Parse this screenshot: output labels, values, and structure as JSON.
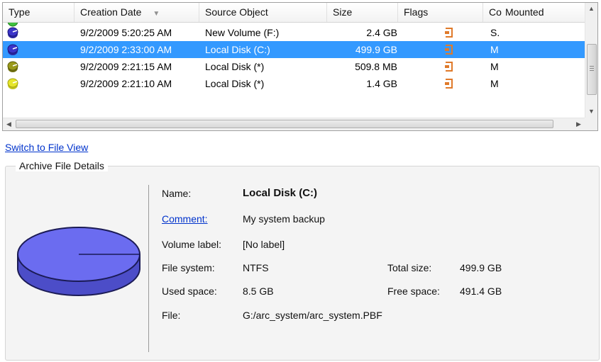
{
  "columns": {
    "type": "Type",
    "creation_date": "Creation Date",
    "source_object": "Source Object",
    "size": "Size",
    "flags": "Flags",
    "co": "Co",
    "mounted": "Mounted"
  },
  "rows": [
    {
      "date": "9/2/2009 5:20:25 AM",
      "source": "New Volume (F:)",
      "size": "2.4 GB",
      "co": "S.",
      "icon_color": "#3b34c9"
    },
    {
      "date": "9/2/2009 2:33:00 AM",
      "source": "Local Disk (C:)",
      "size": "499.9 GB",
      "co": "M",
      "icon_color": "#3b34c9"
    },
    {
      "date": "9/2/2009 2:21:15 AM",
      "source": "Local Disk (*)",
      "size": "509.8 MB",
      "co": "M",
      "icon_color": "#9a9a1a"
    },
    {
      "date": "9/2/2009 2:21:10 AM",
      "source": "Local Disk (*)",
      "size": "1.4 GB",
      "co": "M",
      "icon_color": "#e6e62a"
    }
  ],
  "selected_row": 1,
  "links": {
    "switch_view": "Switch to File View"
  },
  "details": {
    "group_title": "Archive File Details",
    "name_label": "Name:",
    "name_value": "Local Disk (C:)",
    "comment_label": "Comment:",
    "comment_value": "My system backup",
    "volume_label_label": "Volume label:",
    "volume_label_value": "[No label]",
    "file_system_label": "File system:",
    "file_system_value": "NTFS",
    "total_size_label": "Total size:",
    "total_size_value": "499.9 GB",
    "used_space_label": "Used space:",
    "used_space_value": "8.5 GB",
    "free_space_label": "Free space:",
    "free_space_value": "491.4 GB",
    "file_label": "File:",
    "file_value": "G:/arc_system/arc_system.PBF"
  },
  "icons": {
    "disk": "disk-icon",
    "flag": "archive-flag-icon",
    "pie": "disk-usage-pie-icon"
  },
  "colors": {
    "selection": "#3399ff",
    "link": "#0033cc",
    "pie_fill": "#6b6cf0",
    "flag": "#e07a2a"
  }
}
